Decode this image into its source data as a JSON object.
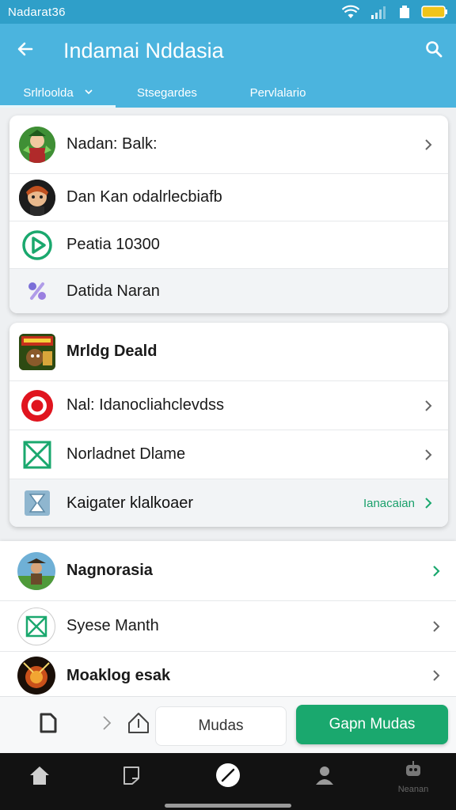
{
  "status_bar": {
    "time": "Nadarat36"
  },
  "app_bar": {
    "title": "Indamai Nddasia"
  },
  "tabs": [
    {
      "label": "Srlrloolda"
    },
    {
      "label": "Stsegardes"
    },
    {
      "label": "Pervlalario"
    }
  ],
  "card1": {
    "items": [
      {
        "label": "Nadan: Balk:"
      },
      {
        "label": "Dan Kan odalrlecbiafb"
      },
      {
        "label": "Peatia 10300"
      },
      {
        "label": "Datida Naran"
      }
    ]
  },
  "card2": {
    "items": [
      {
        "label": "Mrldg Deald"
      },
      {
        "label": "Nal: Idanocliahclevdss"
      },
      {
        "label": "Norladnet Dlame"
      },
      {
        "label": "Kaigater klalkoaer",
        "trailing": "Ianacaian"
      }
    ]
  },
  "card3": {
    "items": [
      {
        "label": "Nagnorasia"
      },
      {
        "label": "Syese Manth"
      },
      {
        "label": "Moaklog esak"
      }
    ]
  },
  "action_bar": {
    "secondary_label": "Mudas",
    "primary_label": "Gapn Mudas"
  },
  "bottom_nav": {
    "last_label": "Neanan"
  },
  "colors": {
    "primary": "#4bb4de",
    "status": "#2f9fc9",
    "accent_green": "#1aa86e"
  }
}
